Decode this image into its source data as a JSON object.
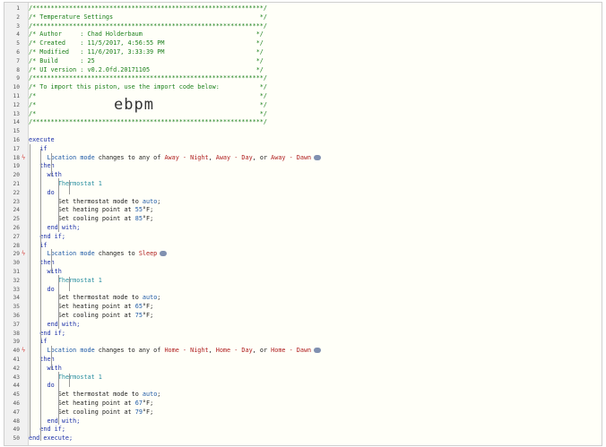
{
  "header": {
    "line1": "/***************************************************************/",
    "title": "/* Temperature Settings                                        */",
    "line3": "/***************************************************************/",
    "author": "/* Author     : Chad Holderbaum                               */",
    "created": "/* Created    : 11/5/2017, 4:56:55 PM                         */",
    "modified": "/* Modified   : 11/6/2017, 3:33:39 PM                         */",
    "build": "/* Build      : 25                                            */",
    "ui": "/* UI version : v0.2.0fd.20171105                             */",
    "line9": "/***************************************************************/",
    "import": "/* To import this piston, use the import code below:           */",
    "blank1": "/*                                                             */",
    "blank2": "/*                                                             */",
    "blank3": "/*                                                             */",
    "line14": "/***************************************************************/",
    "import_code": "ebpm"
  },
  "keywords": {
    "execute": "execute",
    "if": "if",
    "then": "then",
    "with": "with",
    "do": "do",
    "end_with": "end with;",
    "end_if": "end if;",
    "end_execute": "end execute;"
  },
  "blocks": [
    {
      "cond_a": "Location mode",
      "cond_b": " changes to any of ",
      "cond_c": "Away - Night",
      "cond_d": ", ",
      "cond_e": "Away - Day",
      "cond_f": ", or ",
      "cond_g": "Away - Dawn",
      "device": "Thermostat 1",
      "mode_pre": "Set thermostat mode to ",
      "mode": "auto",
      "heat_pre": "Set heating point at ",
      "heat": "55",
      "cool_pre": "Set cooling point at ",
      "cool": "85",
      "unit": "°F;"
    },
    {
      "cond_a": "Location mode",
      "cond_b": " changes to ",
      "cond_c": "Sleep",
      "cond_d": "",
      "cond_e": "",
      "cond_f": "",
      "cond_g": "",
      "device": "Thermostat 1",
      "mode_pre": "Set thermostat mode to ",
      "mode": "auto",
      "heat_pre": "Set heating point at ",
      "heat": "65",
      "cool_pre": "Set cooling point at ",
      "cool": "75",
      "unit": "°F;"
    },
    {
      "cond_a": "Location mode",
      "cond_b": " changes to any of ",
      "cond_c": "Home - Night",
      "cond_d": ", ",
      "cond_e": "Home - Day",
      "cond_f": ", or ",
      "cond_g": "Home - Dawn",
      "device": "Thermostat 1",
      "mode_pre": "Set thermostat mode to ",
      "mode": "auto",
      "heat_pre": "Set heating point at ",
      "heat": "67",
      "cool_pre": "Set cooling point at ",
      "cool": "79",
      "unit": "°F;"
    }
  ],
  "line_numbers": [
    "1",
    "2",
    "3",
    "4",
    "5",
    "6",
    "7",
    "8",
    "9",
    "10",
    "11",
    "12",
    "13",
    "14",
    "15",
    "16",
    "17",
    "18",
    "19",
    "20",
    "21",
    "22",
    "23",
    "24",
    "25",
    "26",
    "27",
    "28",
    "29",
    "30",
    "31",
    "32",
    "33",
    "34",
    "35",
    "36",
    "37",
    "38",
    "39",
    "40",
    "41",
    "42",
    "43",
    "44",
    "45",
    "46",
    "47",
    "48",
    "49",
    "50"
  ],
  "trigger_mark": "ϟ",
  "colors": {
    "keyword": "#1b2fa8",
    "comment": "#1a7f1a",
    "value": "#b02020",
    "trigger": "#d9534f"
  }
}
